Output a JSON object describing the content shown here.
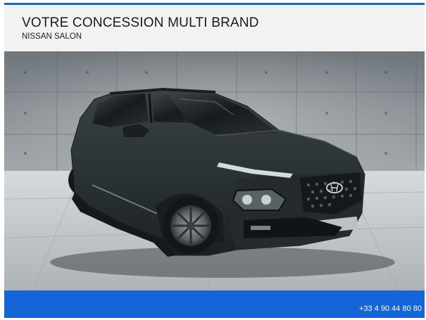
{
  "header": {
    "title": "VOTRE CONCESSION MULTI BRAND",
    "subtitle": "NISSAN SALON"
  },
  "photo": {
    "subject_icon": "car-photo",
    "logo_icon": "hyundai-logo-icon"
  },
  "footer": {
    "phone": "+33 4 90 44 80 80"
  },
  "colors": {
    "accent": "#1466d8",
    "header_bg": "#f2f2f2",
    "car_body": "#2b3236",
    "wall": "#7d8489",
    "floor": "#c9cdd0"
  }
}
